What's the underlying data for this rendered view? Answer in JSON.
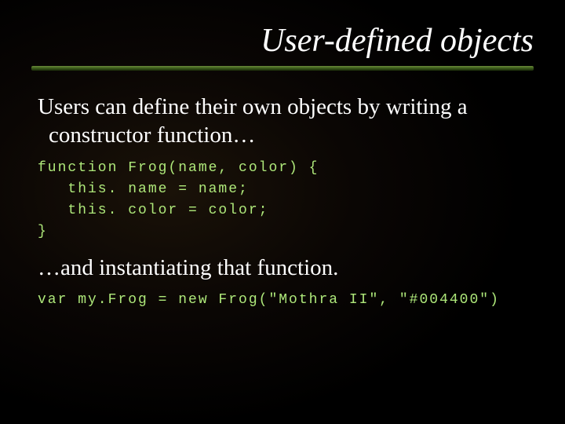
{
  "title": "User-defined objects",
  "para1": "Users can define their own objects by writing a constructor function…",
  "code1": "function Frog(name, color) {\n   this. name = name;\n   this. color = color;\n}",
  "para2": "…and instantiating that function.",
  "code2": "var my.Frog = new Frog(\"Mothra II\", \"#004400\")"
}
